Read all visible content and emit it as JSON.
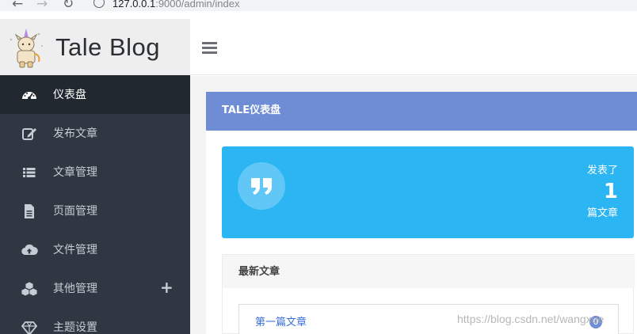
{
  "browser": {
    "url_host": "127.0.0.1",
    "url_path": ":9000/admin/index"
  },
  "brand": {
    "name": "Tale Blog"
  },
  "sidebar": {
    "items": [
      {
        "label": "仪表盘",
        "icon": "dashboard-icon",
        "active": true
      },
      {
        "label": "发布文章",
        "icon": "edit-icon"
      },
      {
        "label": "文章管理",
        "icon": "list-icon"
      },
      {
        "label": "页面管理",
        "icon": "file-icon"
      },
      {
        "label": "文件管理",
        "icon": "cloud-upload-icon"
      },
      {
        "label": "其他管理",
        "icon": "cubes-icon",
        "expand": "+"
      },
      {
        "label": "主题设置",
        "icon": "diamond-icon"
      }
    ]
  },
  "panel": {
    "title": "TALE仪表盘"
  },
  "stat": {
    "top_label": "发表了",
    "count": "1",
    "bottom_label": "篇文章",
    "icon": "quote-icon"
  },
  "latest": {
    "title": "最新文章",
    "items": [
      {
        "title": "第一篇文章",
        "comments": "0"
      }
    ]
  },
  "watermark": "https://blog.csdn.net/wangxue",
  "colors": {
    "sidebar_bg": "#2f3742",
    "sidebar_active": "#22282f",
    "panel_title_bg": "#6f8dd5",
    "stat_bg": "#2bb5f3",
    "link": "#3a6fd8"
  }
}
